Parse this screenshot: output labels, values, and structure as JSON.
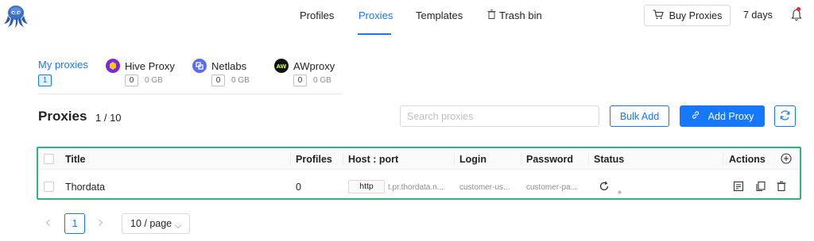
{
  "nav": {
    "items": [
      "Profiles",
      "Proxies",
      "Templates",
      "Trash bin"
    ],
    "active": "Proxies",
    "buy_label": "Buy Proxies",
    "days_label": "7 days"
  },
  "providers": [
    {
      "name": "My proxies",
      "count": "1",
      "gb": ""
    },
    {
      "name": "Hive Proxy",
      "count": "0",
      "gb": "0 GB",
      "logo_color": "#7a2bd9"
    },
    {
      "name": "Netlabs",
      "count": "0",
      "gb": "0 GB",
      "logo_color": "#5b6cf0"
    },
    {
      "name": "AWproxy",
      "count": "0",
      "gb": "0 GB",
      "logo_color": "#111111",
      "logo_text": "AW"
    }
  ],
  "section": {
    "title": "Proxies",
    "count": "1 / 10",
    "search_placeholder": "Search proxies",
    "bulk_add_label": "Bulk Add",
    "add_proxy_label": "Add Proxy"
  },
  "table": {
    "columns": [
      "Title",
      "Profiles",
      "Host : port",
      "Login",
      "Password",
      "Status",
      "Actions"
    ],
    "rows": [
      {
        "title": "Thordata",
        "profiles": "0",
        "protocol": "http",
        "host": "t.pr.thordata.n...",
        "login": "customer-us...",
        "password": "customer-pa..."
      }
    ]
  },
  "pagination": {
    "current": "1",
    "page_size": "10 / page"
  },
  "colors": {
    "accent": "#1677ff",
    "highlight_border": "#2cb67d"
  },
  "icons": [
    "octopus-logo-icon",
    "trash-icon",
    "cart-icon",
    "bell-icon",
    "link-icon",
    "refresh-icon",
    "plus-circle-icon",
    "reload-icon",
    "status-dot-icon",
    "edit-icon",
    "copy-icon",
    "delete-icon",
    "chevron-left-icon",
    "chevron-right-icon",
    "chevron-down-icon"
  ]
}
